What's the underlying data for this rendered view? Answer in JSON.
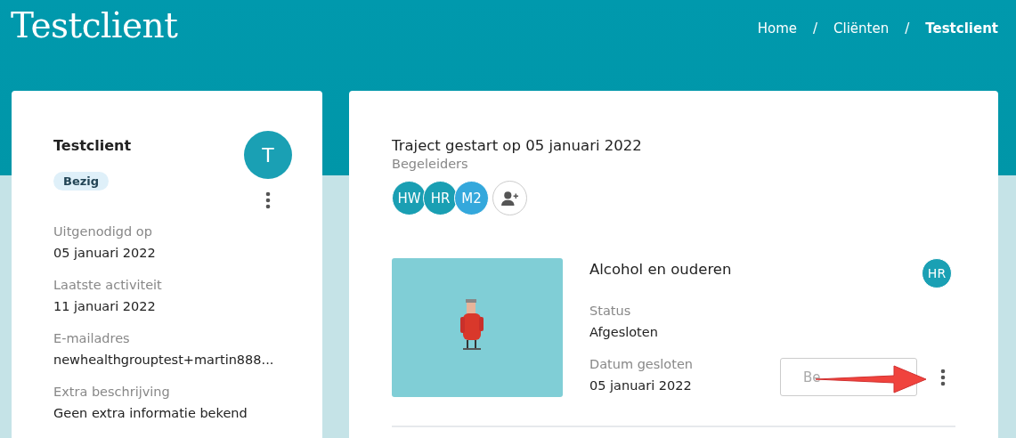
{
  "page_title": "Testclient",
  "breadcrumb": [
    {
      "label": "Home",
      "current": false
    },
    {
      "label": "/",
      "kind": "separator"
    },
    {
      "label": "Cliënten",
      "current": false
    },
    {
      "label": "/",
      "kind": "separator"
    },
    {
      "label": "Testclient",
      "current": true
    }
  ],
  "client_card": {
    "name": "Testclient",
    "avatar": "T",
    "status": "Bezig",
    "fields": [
      {
        "label": "Uitgenodigd op",
        "value": "05 januari 2022"
      },
      {
        "label": "Laatste activiteit",
        "value": "11 januari 2022"
      },
      {
        "label": "E-mailadres",
        "value": "newhealthgrouptest+martin888..."
      },
      {
        "label": "Extra beschrijving",
        "value": "Geen extra informatie bekend"
      }
    ]
  },
  "trajectory": {
    "title": "Traject gestart op 05 januari 2022",
    "coaches_label": "Begeleiders",
    "coaches": [
      {
        "initials": "HW",
        "color": "#1a9fb3"
      },
      {
        "initials": "HR",
        "color": "#1a9fb3"
      },
      {
        "initials": "M2",
        "color": "#34a8dc"
      }
    ],
    "modules": [
      {
        "kind": "picture",
        "title": "Alcohol en ouderen",
        "coach": "HR",
        "fields": [
          {
            "label": "Status",
            "value": "Afgesloten"
          },
          {
            "label": "Datum gesloten",
            "value": "05 januari 2022"
          }
        ],
        "button": "Be"
      }
    ]
  }
}
